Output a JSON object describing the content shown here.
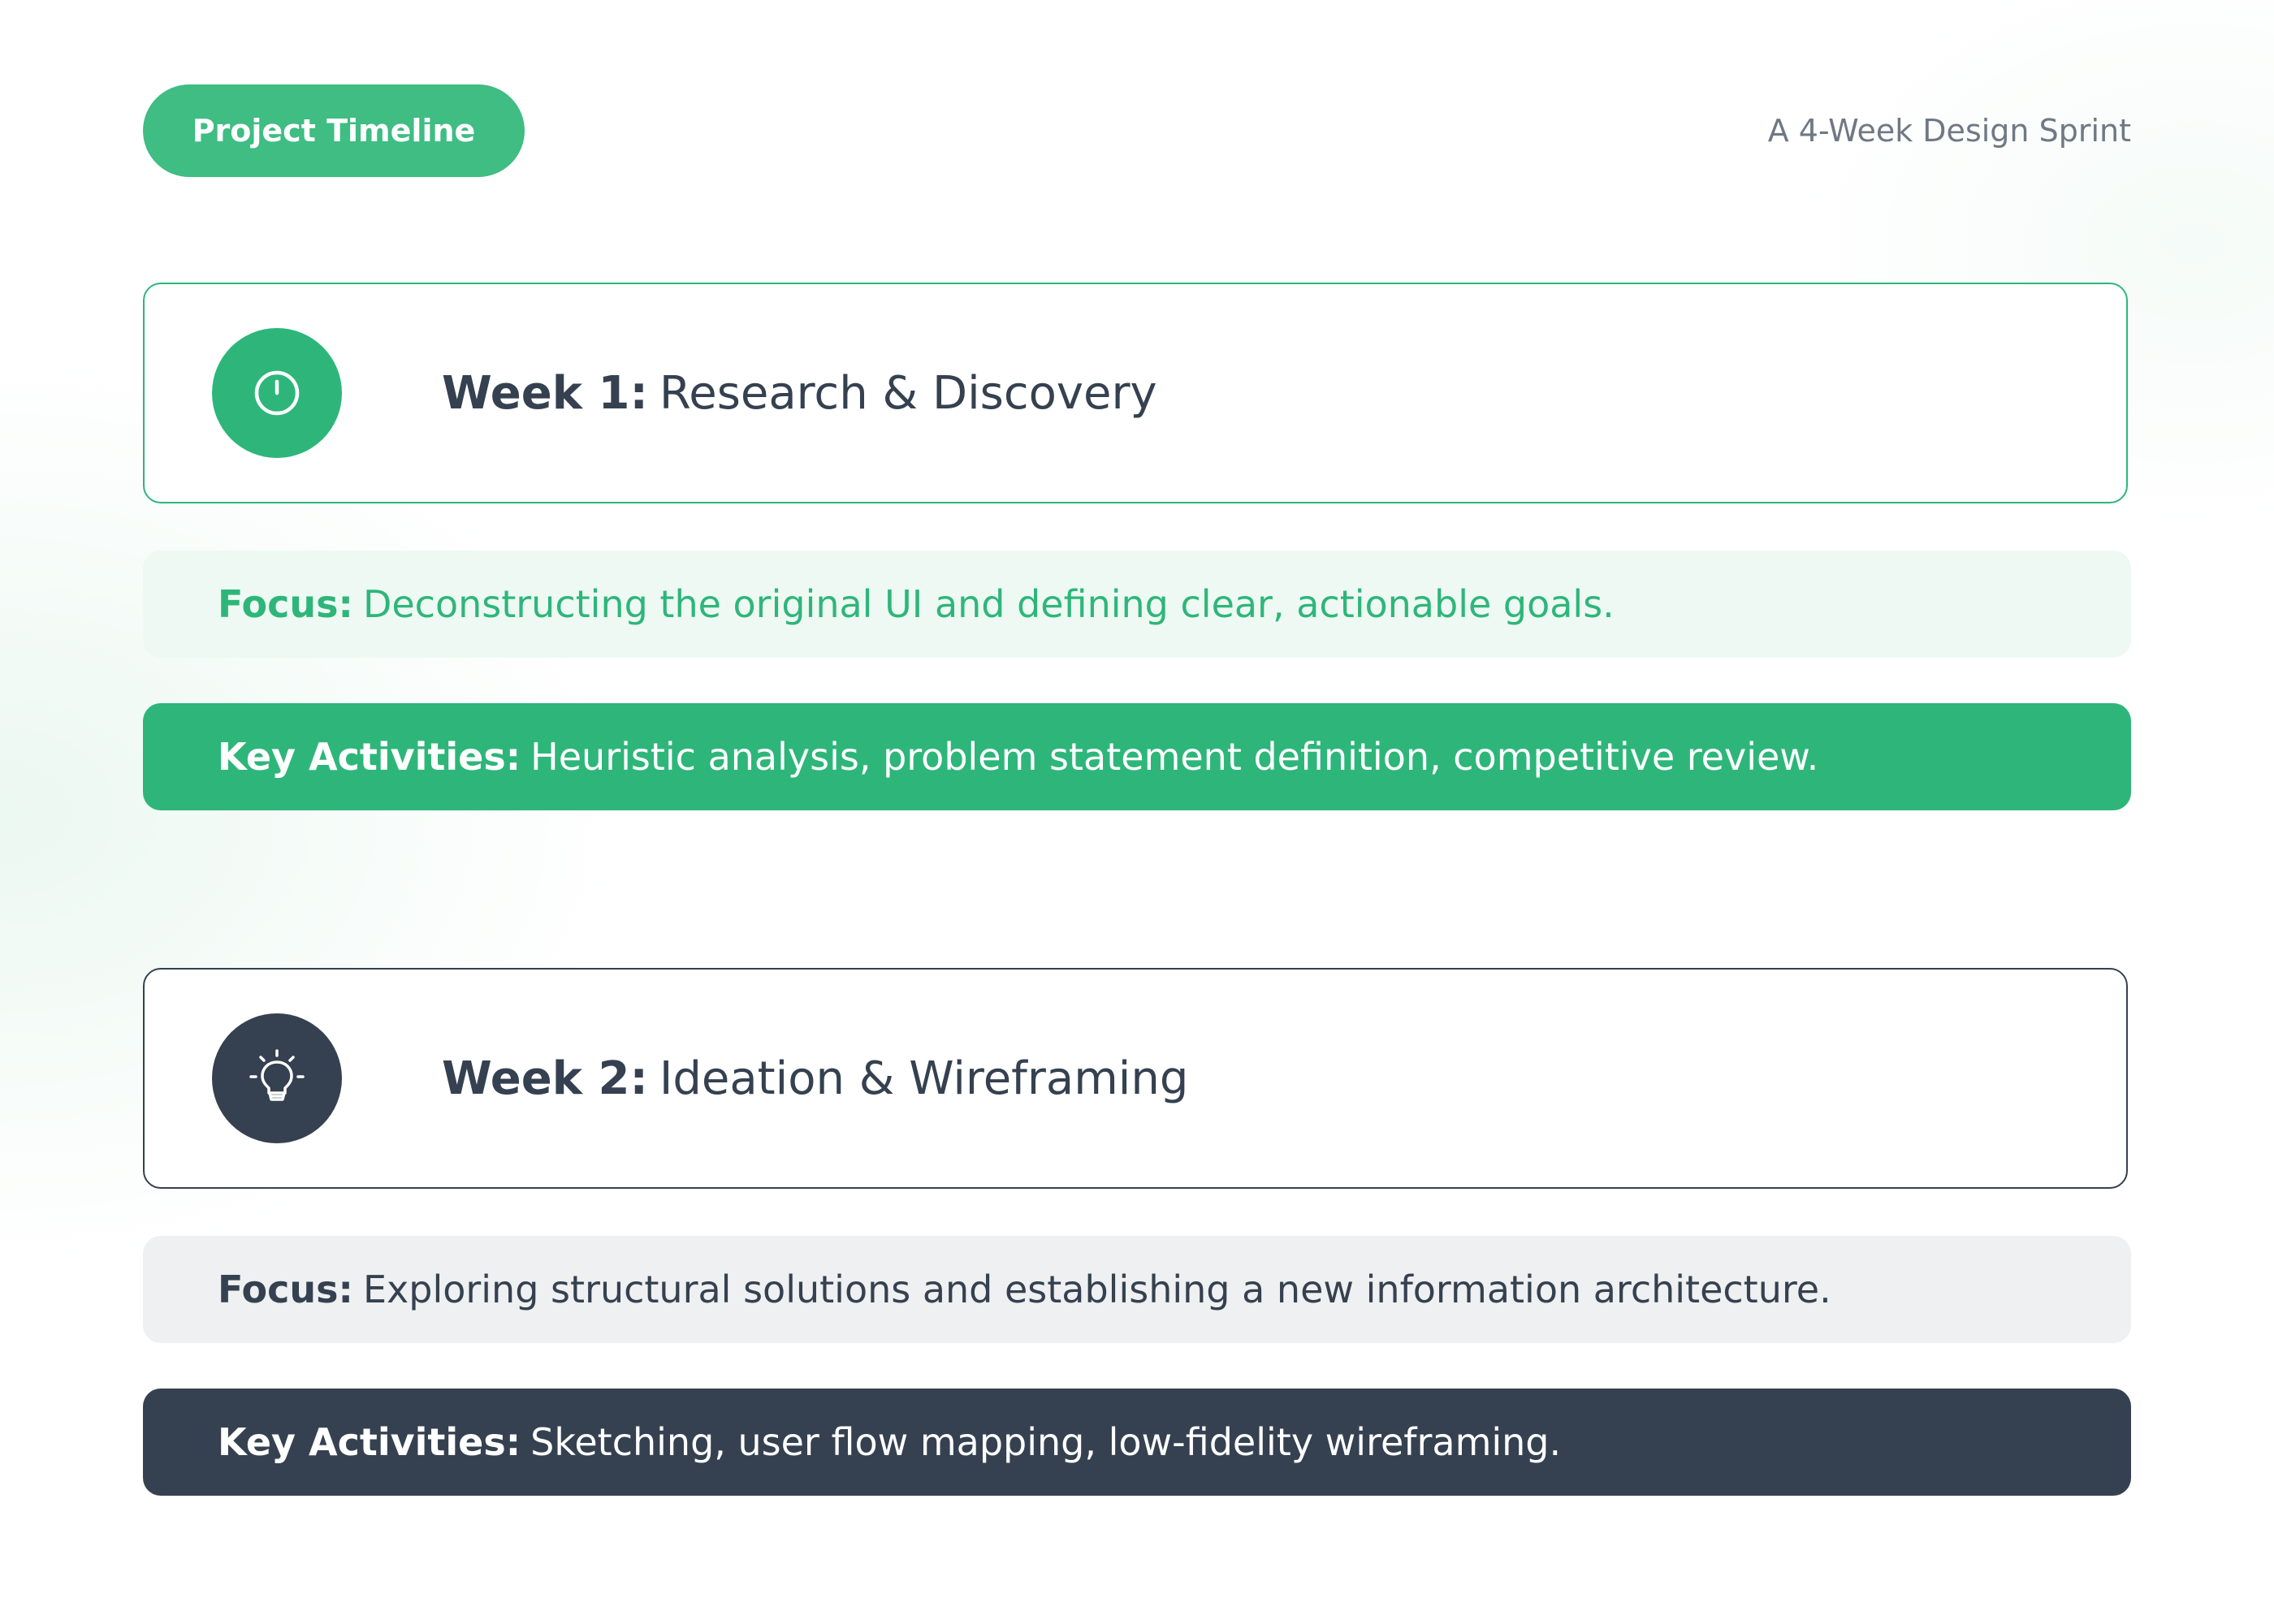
{
  "header": {
    "badge": "Project Timeline",
    "subtitle": "A 4-Week Design Sprint"
  },
  "weeks": [
    {
      "label": "Week 1:",
      "title": "Research & Discovery",
      "icon": "power-icon",
      "focus_label": "Focus:",
      "focus_text": "Deconstructing the original UI and defining clear, actionable goals.",
      "activities_label": "Key Activities:",
      "activities_text": "Heuristic analysis, problem statement definition, competitive review."
    },
    {
      "label": "Week 2:",
      "title": "Ideation & Wireframing",
      "icon": "lightbulb-icon",
      "focus_label": "Focus:",
      "focus_text": "Exploring structural solutions and establishing a new information architecture.",
      "activities_label": "Key Activities:",
      "activities_text": "Sketching, user flow mapping, low-fidelity wireframing."
    }
  ],
  "colors": {
    "accent_green": "#2eb67a",
    "pill_green": "#3fbd83",
    "dark_slate": "#354150",
    "focus_green_bg": "#eef9f3",
    "focus_gray_bg": "#eef0f1"
  }
}
